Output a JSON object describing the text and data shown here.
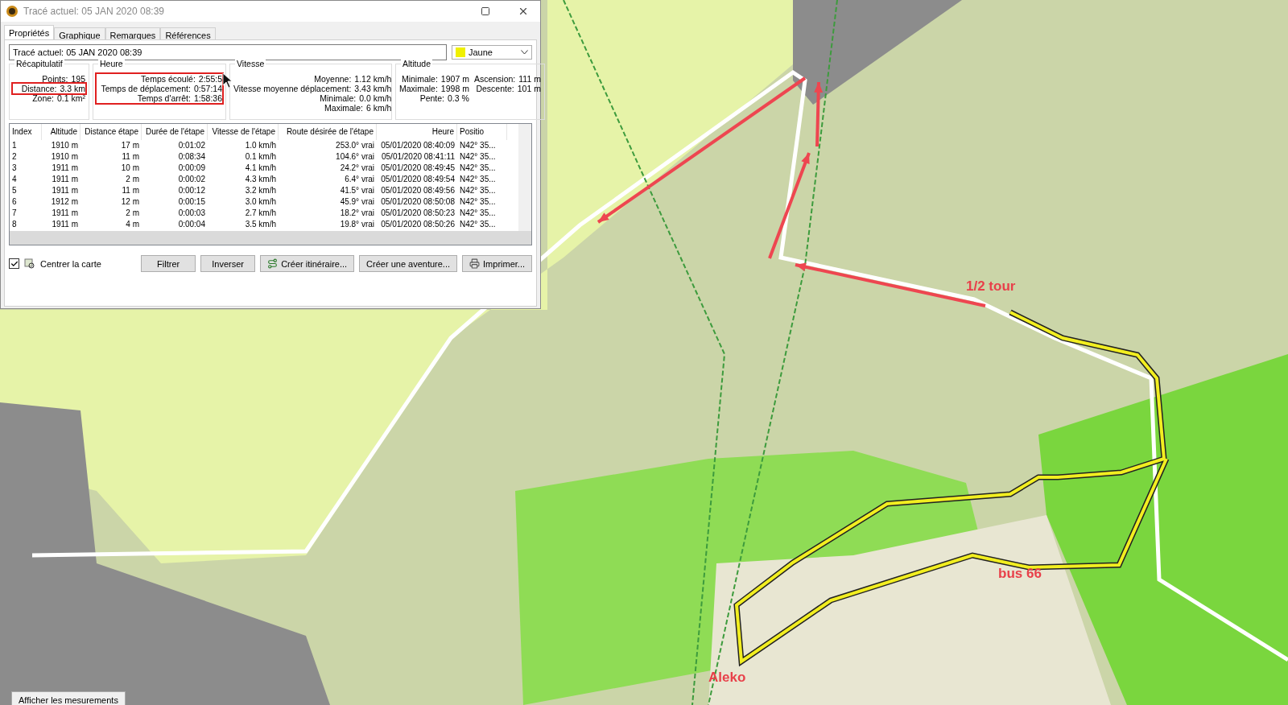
{
  "window": {
    "title": "Tracé actuel: 05 JAN 2020 08:39"
  },
  "tabs": [
    {
      "label": "Propriétés",
      "selected": true
    },
    {
      "label": "Graphique",
      "selected": false
    },
    {
      "label": "Remarques",
      "selected": false
    },
    {
      "label": "Références",
      "selected": false
    }
  ],
  "track_name": {
    "value": "Tracé actuel: 05 JAN 2020 08:39"
  },
  "track_color": {
    "label": "Jaune",
    "color": "#f0f000"
  },
  "groups": [
    {
      "title": "Récapitulatif",
      "highlighted": false,
      "rows": [
        {
          "label": "Points:",
          "value": "195",
          "highlighted": false
        },
        {
          "label": "Distance:",
          "value": "3.3 km",
          "highlighted": true
        },
        {
          "label": "Zone:",
          "value": "0.1 km²",
          "highlighted": false
        }
      ]
    },
    {
      "title": "Heure",
      "highlighted": true,
      "rows": [
        {
          "label": "Temps écoulé:",
          "value": "2:55:5",
          "highlighted": false
        },
        {
          "label": "Temps de déplacement:",
          "value": "0:57:14",
          "highlighted": false
        },
        {
          "label": "Temps d'arrêt:",
          "value": "1:58:36",
          "highlighted": false
        }
      ]
    },
    {
      "title": "Vitesse",
      "highlighted": false,
      "rows": [
        {
          "label": "Moyenne:",
          "value": "1.12 km/h",
          "highlighted": false
        },
        {
          "label": "Vitesse moyenne déplacement:",
          "value": "3.43 km/h",
          "highlighted": false
        },
        {
          "label": "Minimale:",
          "value": "0.0 km/h",
          "highlighted": false
        },
        {
          "label": "Maximale:",
          "value": "6 km/h",
          "highlighted": false
        }
      ]
    },
    {
      "title": "Altitude",
      "highlighted": false,
      "rows": [
        {
          "label": "Minimale:",
          "value": "1907 m",
          "highlighted": false
        },
        {
          "label": "Ascension:",
          "value": "111 m",
          "highlighted": false
        },
        {
          "label": "Maximale:",
          "value": "1998 m",
          "highlighted": false
        },
        {
          "label": "Descente:",
          "value": "101 m",
          "highlighted": false
        },
        {
          "label": "Pente:",
          "value": "0.3 %",
          "highlighted": false
        }
      ]
    }
  ],
  "table": {
    "columns": [
      "Index",
      "Altitude",
      "Distance étape",
      "Durée de l'étape",
      "Vitesse de l'étape",
      "Route désirée de l'étape",
      "Heure",
      "Positio"
    ],
    "rows": [
      [
        "1",
        "1910 m",
        "17 m",
        "0:01:02",
        "1.0 km/h",
        "253.0° vrai",
        "05/01/2020 08:40:09",
        "N42° 35..."
      ],
      [
        "2",
        "1910 m",
        "11 m",
        "0:08:34",
        "0.1 km/h",
        "104.6° vrai",
        "05/01/2020 08:41:11",
        "N42° 35..."
      ],
      [
        "3",
        "1911 m",
        "10 m",
        "0:00:09",
        "4.1 km/h",
        "24.2° vrai",
        "05/01/2020 08:49:45",
        "N42° 35..."
      ],
      [
        "4",
        "1911 m",
        "2 m",
        "0:00:02",
        "4.3 km/h",
        "6.4° vrai",
        "05/01/2020 08:49:54",
        "N42° 35..."
      ],
      [
        "5",
        "1911 m",
        "11 m",
        "0:00:12",
        "3.2 km/h",
        "41.5° vrai",
        "05/01/2020 08:49:56",
        "N42° 35..."
      ],
      [
        "6",
        "1912 m",
        "12 m",
        "0:00:15",
        "3.0 km/h",
        "45.9° vrai",
        "05/01/2020 08:50:08",
        "N42° 35..."
      ],
      [
        "7",
        "1911 m",
        "2 m",
        "0:00:03",
        "2.7 km/h",
        "18.2° vrai",
        "05/01/2020 08:50:23",
        "N42° 35..."
      ],
      [
        "8",
        "1911 m",
        "4 m",
        "0:00:04",
        "3.5 km/h",
        "19.8° vrai",
        "05/01/2020 08:50:26",
        "N42° 35..."
      ]
    ]
  },
  "center_map": {
    "label": "Centrer la carte",
    "checked": true
  },
  "buttons": [
    {
      "label": "Filtrer",
      "kind": "plain"
    },
    {
      "label": "Inverser",
      "kind": "plain"
    },
    {
      "label": "Créer itinéraire...",
      "kind": "route"
    },
    {
      "label": "Créer une aventure...",
      "kind": "plain"
    },
    {
      "label": "Imprimer...",
      "kind": "print"
    }
  ],
  "map": {
    "annotations": [
      {
        "text": "1/2 tour"
      },
      {
        "text": "bus 66"
      },
      {
        "text": "Aleko"
      }
    ],
    "measure_button": "Afficher les mesurements"
  }
}
